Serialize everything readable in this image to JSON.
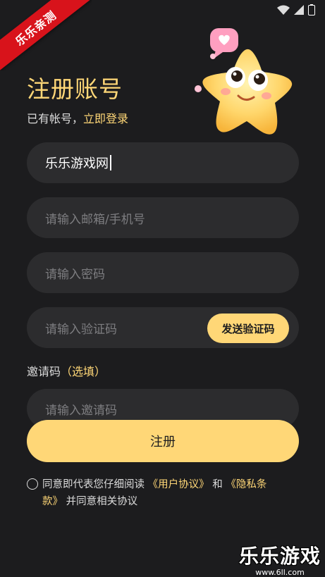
{
  "ribbon": {
    "text": "乐乐亲测"
  },
  "header": {
    "title": "注册账号",
    "login_prefix": "已有帐号，",
    "login_link": "立即登录"
  },
  "form": {
    "username_value": "乐乐游戏网",
    "account_placeholder": "请输入邮箱/手机号",
    "password_placeholder": "请输入密码",
    "code_placeholder": "请输入验证码",
    "send_code_label": "发送验证码",
    "invite_label": "邀请码",
    "invite_optional": "（选填）",
    "invite_placeholder": "请输入邀请码",
    "register_label": "注册"
  },
  "agreement": {
    "text_1": "同意即代表您仔细阅读",
    "user_agreement": "《用户协议》",
    "and": "和",
    "privacy_1": "《隐私条",
    "privacy_2": "款》",
    "text_2": "并同意相关协议"
  },
  "watermark": {
    "title": "乐乐游戏",
    "url": "www.6ll.com"
  },
  "colors": {
    "background": "#1c1c1e",
    "field": "#2c2c2e",
    "accent": "#ffd777"
  }
}
